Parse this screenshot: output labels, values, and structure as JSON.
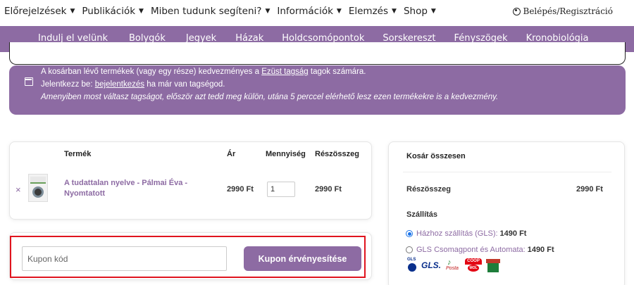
{
  "top_menu": {
    "items": [
      {
        "label": "Előrejelzések",
        "caret": "▼"
      },
      {
        "label": "Publikációk",
        "caret": "▼"
      },
      {
        "label": "Miben tudunk segíteni?",
        "caret": "▼"
      },
      {
        "label": "Információk",
        "caret": "▼"
      },
      {
        "label": "Elemzés",
        "caret": "▼"
      },
      {
        "label": "Shop",
        "caret": "▼"
      }
    ],
    "login_label": "Belépés/Regisztráció"
  },
  "sub_menu": {
    "items": [
      "Indulj el velünk",
      "Bolygók",
      "Jegyek",
      "Házak",
      "Holdcsomópontok",
      "Sorskereszt",
      "Fényszögek",
      "Kronobiológia"
    ]
  },
  "notice": {
    "line1_before": "A kosárban lévő termékek (vagy egy része) kedvezményes a ",
    "line1_link": "Ezüst tagság",
    "line1_after": " tagok számára.",
    "line2_before": "Jelentkezz be: ",
    "line2_link": "bejelentkezés",
    "line2_after": " ha már van tagségod.",
    "line3": "Amenyiben most váltasz tagságot, először azt tedd meg külön, utána 5 perccel elérhető lesz ezen termékekre is a kedvezmény."
  },
  "cart": {
    "headers": {
      "product": "Termék",
      "price": "Ár",
      "quantity": "Mennyiség",
      "subtotal": "Részösszeg"
    },
    "remove_symbol": "×",
    "item": {
      "name": "A tudattalan nyelve - Pálmai Éva - Nyomtatott",
      "price": "2990 Ft",
      "quantity": "1",
      "subtotal": "2990 Ft"
    }
  },
  "coupon": {
    "placeholder": "Kupon kód",
    "button_label": "Kupon érvényesítése"
  },
  "totals": {
    "title": "Kosár összesen",
    "subtotal_label": "Részösszeg",
    "subtotal_value": "2990 Ft",
    "shipping_label": "Szállítás",
    "options": [
      {
        "label": "Házhoz szállítás (GLS):",
        "price": "1490 Ft",
        "selected": true
      },
      {
        "label": "GLS Csomagpont és Automata:",
        "price": "1490 Ft",
        "selected": false
      }
    ],
    "logos": {
      "gls_pin": "GLS",
      "gls": "GLS.",
      "posta": "Posta",
      "coop_top": "COOP",
      "coop_bottom": "MOL"
    }
  },
  "colors": {
    "accent": "#8d6ba3",
    "highlight": "#e0141e",
    "radio": "#1a73e8"
  }
}
